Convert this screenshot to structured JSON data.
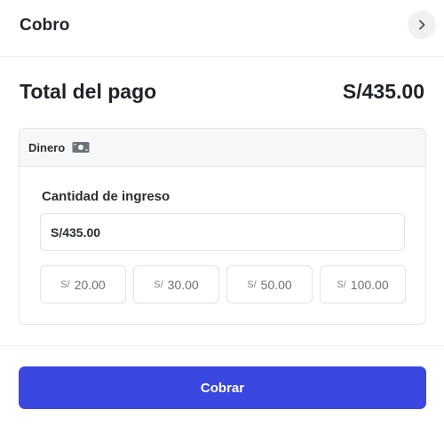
{
  "header": {
    "title": "Cobro",
    "close_icon": "chevron-right-icon"
  },
  "summary": {
    "total_label": "Total del pago",
    "total_amount": "S/435.00"
  },
  "payment_method": {
    "name": "Dinero",
    "icon": "cash-icon",
    "amount_label": "Cantidad de ingreso",
    "amount_value": "S/435.00",
    "quick_amounts": [
      {
        "currency": "S/",
        "value": "20.00"
      },
      {
        "currency": "S/",
        "value": "30.00"
      },
      {
        "currency": "S/",
        "value": "50.00"
      },
      {
        "currency": "S/",
        "value": "100.00"
      }
    ]
  },
  "actions": {
    "charge_label": "Cobrar"
  },
  "colors": {
    "primary": "#3a47e0",
    "text": "#1f2327",
    "muted": "#707780",
    "border": "#dfe2e6"
  }
}
